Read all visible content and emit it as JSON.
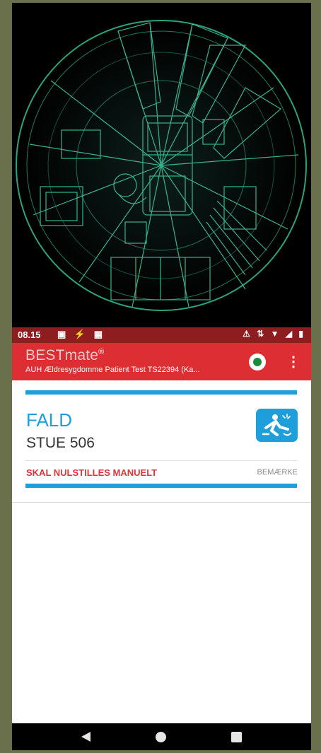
{
  "status_bar": {
    "time": "08.15",
    "left_icons": "▣ ⚡ ▦",
    "right_icons": "⚠ ⇅ ▼ ◢ ▮"
  },
  "app_bar": {
    "brand": "BESTmate",
    "brand_mark": "®",
    "subtitle": "AUH Ældresygdomme Patient Test TS22394 (Ka...",
    "menu_glyph": "⋮",
    "status_color": "#1b8a3b"
  },
  "alert": {
    "title": "FALD",
    "room": "STUE 506",
    "reset_text": "SKAL NULSTILLES MANUELT",
    "note_label": "BEMÆRKE",
    "accent_color": "#1e9fdc",
    "icon": "person-falling-icon"
  },
  "colors": {
    "app_bar": "#dd2e33",
    "status_bar": "#8e1d1f",
    "camera_lines": "#3fc39a",
    "outer_background": "#69704b"
  },
  "nav": {
    "back": "back-icon",
    "home": "home-icon",
    "recent": "recent-apps-icon"
  }
}
